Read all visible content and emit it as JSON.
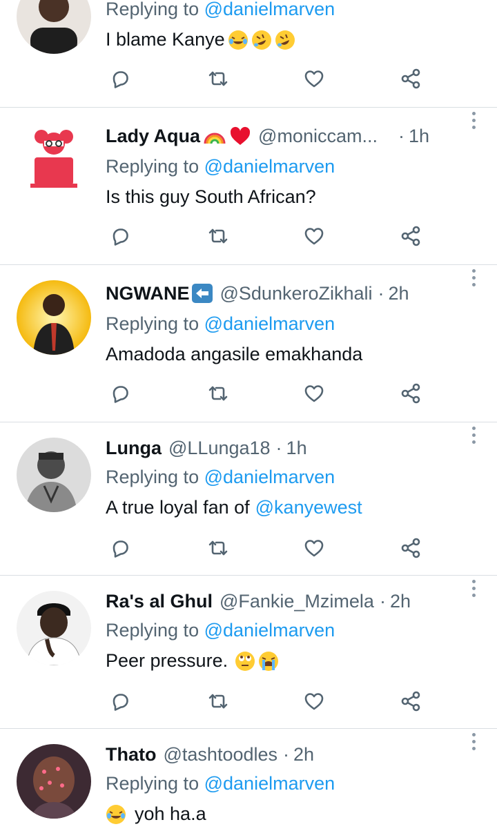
{
  "tweets": [
    {
      "name": "",
      "handle": "",
      "time": "",
      "replying_prefix": "Replying to",
      "replying_to": "@danielmarven",
      "text": "I blame Kanye"
    },
    {
      "name": "Lady Aqua",
      "handle": "@moniccam...",
      "time": "1h",
      "replying_prefix": "Replying to",
      "replying_to": "@danielmarven",
      "text": "Is this guy South African?"
    },
    {
      "name": "NGWANE",
      "handle": "@SdunkeroZikhali",
      "time": "2h",
      "replying_prefix": "Replying to",
      "replying_to": "@danielmarven",
      "text": "Amadoda angasile emakhanda"
    },
    {
      "name": "Lunga",
      "handle": "@LLunga18",
      "time": "1h",
      "replying_prefix": "Replying to",
      "replying_to": "@danielmarven",
      "text": "A true loyal fan of",
      "mention": "@kanyewest"
    },
    {
      "name": "Ra's al Ghul",
      "handle": "@Fankie_Mzimela",
      "time": "2h",
      "replying_prefix": "Replying to",
      "replying_to": "@danielmarven",
      "text": "Peer pressure."
    },
    {
      "name": "Thato",
      "handle": "@tashtoodles",
      "time": "2h",
      "replying_prefix": "Replying to",
      "replying_to": "@danielmarven",
      "text": "yoh ha.a"
    }
  ],
  "separator": "·",
  "icons": [
    "reply-icon",
    "retweet-icon",
    "like-icon",
    "share-icon",
    "more-icon"
  ],
  "colors": {
    "link": "#1d9bf0",
    "secondary": "#536471",
    "icon": "#536471",
    "divider": "#d9dee2"
  }
}
